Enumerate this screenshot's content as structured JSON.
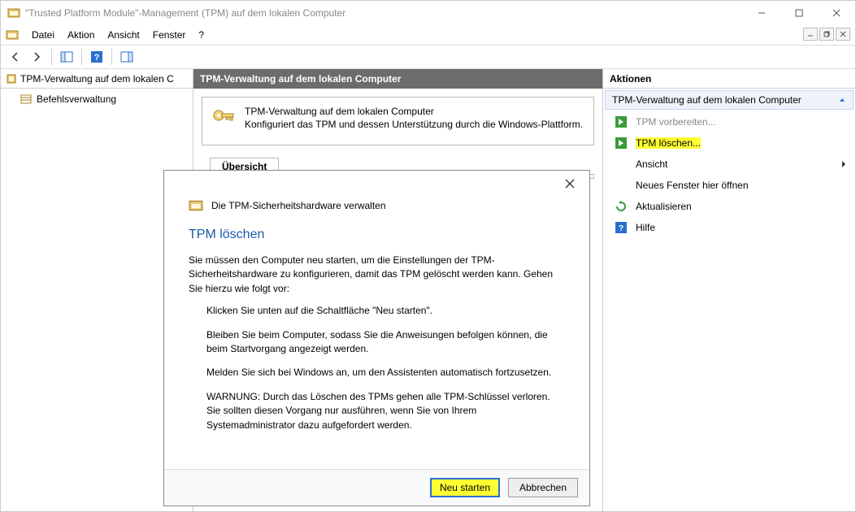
{
  "titlebar": {
    "title": "\"Trusted Platform Module\"-Management (TPM) auf dem lokalen Computer"
  },
  "menu": {
    "file": "Datei",
    "action": "Aktion",
    "view": "Ansicht",
    "window": "Fenster",
    "help": "?"
  },
  "leftpane": {
    "root": "TPM-Verwaltung auf dem lokalen C",
    "child1": "Befehlsverwaltung"
  },
  "midpane": {
    "header": "TPM-Verwaltung auf dem lokalen Computer",
    "intro_title": "TPM-Verwaltung auf dem lokalen Computer",
    "intro_desc": "Konfiguriert das TPM und dessen Unterstützung durch die Windows-Plattform.",
    "overview": "Übersicht"
  },
  "rightpane": {
    "header": "Aktionen",
    "section": "TPM-Verwaltung auf dem lokalen Computer",
    "prepare": "TPM vorbereiten...",
    "clear": "TPM löschen...",
    "view": "Ansicht",
    "newwin": "Neues Fenster hier öffnen",
    "refresh": "Aktualisieren",
    "help": "Hilfe"
  },
  "modal": {
    "title": "Die TPM-Sicherheitshardware verwalten",
    "subtitle": "TPM löschen",
    "p1": "Sie müssen den Computer neu starten, um die Einstellungen der TPM-Sicherheitshardware zu konfigurieren, damit das TPM gelöscht werden kann. Gehen Sie hierzu wie folgt vor:",
    "li1": "Klicken Sie unten auf die Schaltfläche \"Neu starten\".",
    "li2": "Bleiben Sie beim Computer, sodass Sie die Anweisungen befolgen können, die beim Startvorgang angezeigt werden.",
    "li3": "Melden Sie sich bei Windows an, um den Assistenten automatisch fortzusetzen.",
    "li4": "WARNUNG: Durch das Löschen des TPMs gehen alle TPM-Schlüssel verloren. Sie sollten diesen Vorgang nur ausführen, wenn Sie von Ihrem Systemadministrator dazu aufgefordert werden.",
    "restart": "Neu starten",
    "cancel": "Abbrechen"
  }
}
